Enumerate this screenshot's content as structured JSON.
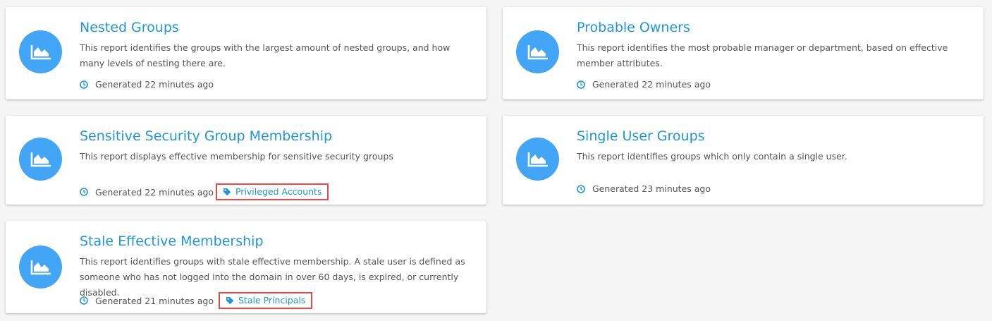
{
  "colors": {
    "accent": "#2196d6",
    "icon_bg": "#42a5f5",
    "highlight": "#e04a4a"
  },
  "icons": {
    "report": "area-chart-icon",
    "time": "clock-icon",
    "tag": "tag-icon"
  },
  "reports": [
    {
      "title": "Nested Groups",
      "description": "This report identifies the groups with the largest amount of nested groups, and how many levels of nesting there are.",
      "generated": "Generated 22 minutes ago"
    },
    {
      "title": "Probable Owners",
      "description": "This report identifies the most probable manager or department, based on effective member attributes.",
      "generated": "Generated 22 minutes ago"
    },
    {
      "title": "Sensitive Security Group Membership",
      "description": "This report displays effective membership for sensitive security groups",
      "generated": "Generated 22 minutes ago",
      "tag": "Privileged Accounts"
    },
    {
      "title": "Single User Groups",
      "description": "This report identifies groups which only contain a single user.",
      "generated": "Generated 23 minutes ago"
    },
    {
      "title": "Stale Effective Membership",
      "description": "This report identifies groups with stale effective membership. A stale user is defined as someone who has not logged into the domain in over 60 days, is expired, or currently disabled.",
      "generated": "Generated 21 minutes ago",
      "tag": "Stale Principals"
    }
  ]
}
